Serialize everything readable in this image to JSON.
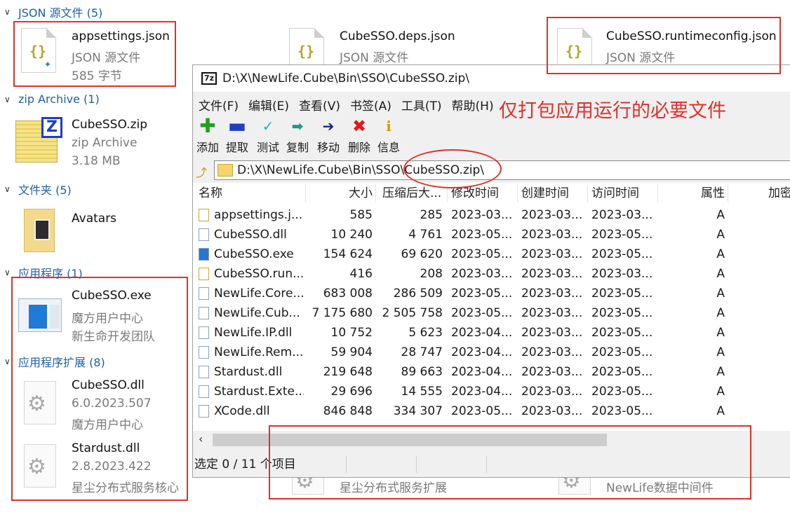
{
  "groups": {
    "json": "JSON 源文件 (5)",
    "zip": "zip Archive (1)",
    "folder": "文件夹 (5)",
    "app": "应用程序 (1)",
    "ext": "应用程序扩展 (8)"
  },
  "json_items": [
    {
      "name": "appsettings.json",
      "type": "JSON 源文件",
      "size": "585 字节"
    },
    {
      "name": "CubeSSO.deps.json",
      "type": "JSON 源文件"
    },
    {
      "name": "CubeSSO.runtimeconfig.json",
      "type": "JSON 源文件"
    }
  ],
  "zip_item": {
    "name": "CubeSSO.zip",
    "type": "zip Archive",
    "size": "3.18 MB"
  },
  "folder_item": {
    "name": "Avatars"
  },
  "app_item": {
    "name": "CubeSSO.exe",
    "line1": "魔方用户中心",
    "line2": "新生命开发团队"
  },
  "ext_items": [
    {
      "name": "CubeSSO.dll",
      "line1": "6.0.2023.507",
      "line2": "魔方用户中心"
    },
    {
      "name": "Stardust.dll",
      "line1": "2.8.2023.422",
      "line2": "星尘分布式服务核心"
    }
  ],
  "hidden_descs": [
    "星尘分布式服务扩展",
    "NewLife数据中间件"
  ],
  "window": {
    "title": "D:\\X\\NewLife.Cube\\Bin\\SSO\\CubeSSO.zip\\",
    "menu": [
      "文件(F)",
      "编辑(E)",
      "查看(V)",
      "书签(A)",
      "工具(T)",
      "帮助(H)"
    ],
    "toolbar": [
      "添加",
      "提取",
      "测试",
      "复制",
      "移动",
      "删除",
      "信息"
    ],
    "address": "D:\\X\\NewLife.Cube\\Bin\\SSO\\CubeSSO.zip\\",
    "columns": [
      "名称",
      "大小",
      "压缩后大...",
      "修改时间",
      "创建时间",
      "访问时间",
      "属性",
      "加密"
    ],
    "rows": [
      [
        "appsettings.j...",
        "585",
        "285",
        "2023-03...",
        "2023-03...",
        "2023-03...",
        "A",
        "-"
      ],
      [
        "CubeSSO.dll",
        "10 240",
        "4 761",
        "2023-05...",
        "2023-03...",
        "2023-05...",
        "A",
        "-"
      ],
      [
        "CubeSSO.exe",
        "154 624",
        "69 620",
        "2023-05...",
        "2023-03...",
        "2023-05...",
        "A",
        "-"
      ],
      [
        "CubeSSO.run...",
        "416",
        "208",
        "2023-03...",
        "2023-03...",
        "2023-03...",
        "A",
        "-"
      ],
      [
        "NewLife.Core...",
        "683 008",
        "286 509",
        "2023-05...",
        "2023-03...",
        "2023-05...",
        "A",
        "-"
      ],
      [
        "NewLife.Cub...",
        "7 175 680",
        "2 505 758",
        "2023-05...",
        "2023-03...",
        "2023-05...",
        "A",
        "-"
      ],
      [
        "NewLife.IP.dll",
        "10 752",
        "5 623",
        "2023-04...",
        "2023-03...",
        "2023-05...",
        "A",
        "-"
      ],
      [
        "NewLife.Rem...",
        "59 904",
        "28 747",
        "2023-04...",
        "2023-03...",
        "2023-05...",
        "A",
        "-"
      ],
      [
        "Stardust.dll",
        "219 648",
        "89 663",
        "2023-04...",
        "2023-03...",
        "2023-05...",
        "A",
        "-"
      ],
      [
        "Stardust.Exte...",
        "29 696",
        "14 555",
        "2023-04...",
        "2023-03...",
        "2023-05...",
        "A",
        "-"
      ],
      [
        "XCode.dll",
        "846 848",
        "334 307",
        "2023-05...",
        "2023-03...",
        "2023-05...",
        "A",
        "-"
      ]
    ],
    "status": "选定 0 / 11 个项目"
  },
  "annotation": "仅打包应用运行的必要文件",
  "colors": {
    "annotation": "#e0312b",
    "group_header": "#1d5fa8"
  }
}
